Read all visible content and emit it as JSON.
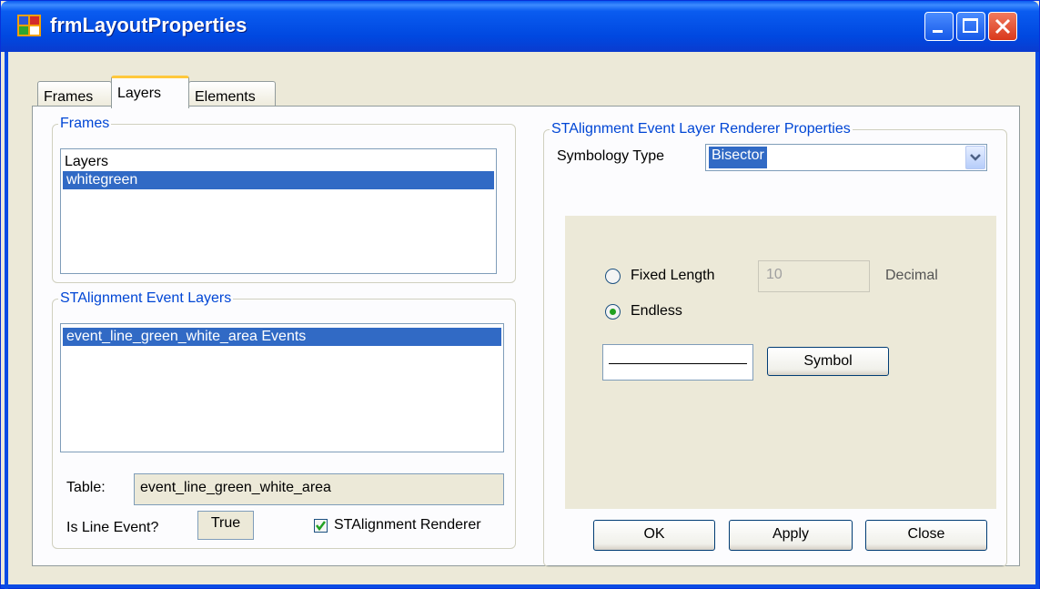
{
  "window": {
    "title": "frmLayoutProperties",
    "icons": {
      "app": "form-app-icon",
      "minimize": "minimize-icon",
      "maximize": "maximize-icon",
      "close": "close-icon"
    }
  },
  "tabs": [
    {
      "label": "Frames",
      "active": false
    },
    {
      "label": "Layers",
      "active": true
    },
    {
      "label": "Elements",
      "active": false
    }
  ],
  "frames_group": {
    "title": "Frames",
    "items": [
      {
        "label": "Layers",
        "selected": false
      },
      {
        "label": "whitegreen",
        "selected": true
      }
    ]
  },
  "event_layers_group": {
    "title": "STAlignment Event Layers",
    "items": [
      {
        "label": "event_line_green_white_area Events",
        "selected": true
      }
    ],
    "table_label": "Table:",
    "table_value": "event_line_green_white_area",
    "is_line_event_label": "Is Line Event?",
    "is_line_event_value": "True",
    "renderer_checkbox_label": "STAlignment Renderer",
    "renderer_checked": true
  },
  "renderer_group": {
    "title": "STAlignment Event Layer Renderer Properties",
    "symbology_label": "Symbology Type",
    "symbology_value": "Bisector",
    "fixed_length_label": "Fixed Length",
    "fixed_length_value": "10",
    "fixed_length_unit": "Decimal",
    "endless_label": "Endless",
    "selected_option": "Endless",
    "symbol_button": "Symbol"
  },
  "buttons": {
    "ok": "OK",
    "apply": "Apply",
    "close": "Close"
  },
  "colors": {
    "selection": "#316ac5",
    "group_title": "#0046d5",
    "titlebar": "#0a5cf0"
  }
}
